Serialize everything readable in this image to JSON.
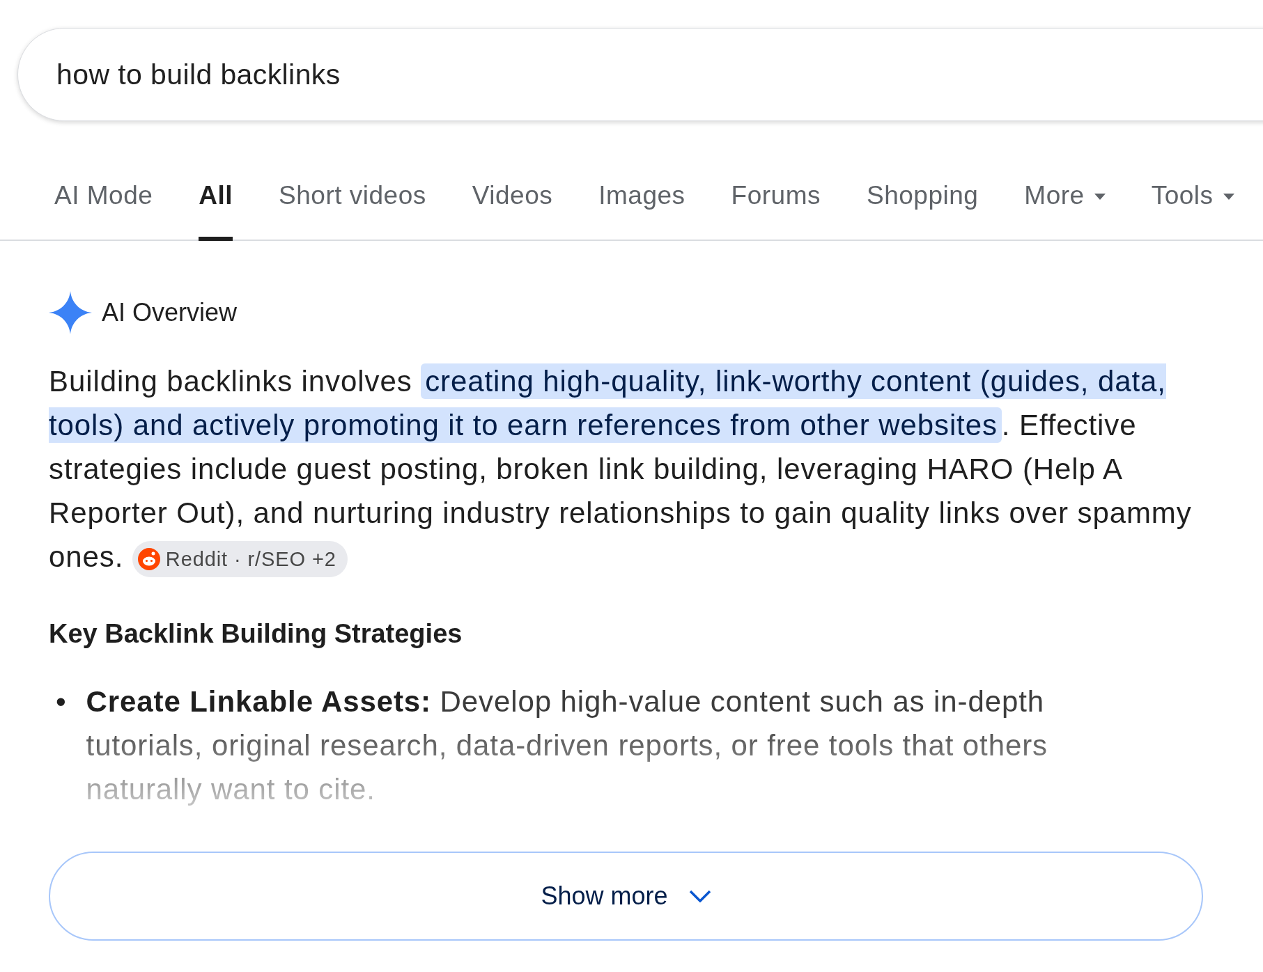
{
  "search": {
    "value": "how to build backlinks"
  },
  "tabs": [
    {
      "label": "AI Mode",
      "selected": false,
      "dropdown": false
    },
    {
      "label": "All",
      "selected": true,
      "dropdown": false
    },
    {
      "label": "Short videos",
      "selected": false,
      "dropdown": false
    },
    {
      "label": "Videos",
      "selected": false,
      "dropdown": false
    },
    {
      "label": "Images",
      "selected": false,
      "dropdown": false
    },
    {
      "label": "Forums",
      "selected": false,
      "dropdown": false
    },
    {
      "label": "Shopping",
      "selected": false,
      "dropdown": false
    },
    {
      "label": "More",
      "selected": false,
      "dropdown": true
    },
    {
      "label": "Tools",
      "selected": false,
      "dropdown": true
    }
  ],
  "overview": {
    "title": "AI Overview",
    "paragraph": [
      {
        "text": "Building backlinks involves ",
        "highlighted": false
      },
      {
        "text": "creating high-quality, link-worthy content (guides, data, tools) and actively promoting it to earn references from other websites",
        "highlighted": true
      },
      {
        "text": ". Effective strategies include guest posting, broken link building, leveraging HARO (Help A Reporter Out), and nurturing industry relationships to gain quality links over spammy ones. ",
        "highlighted": false
      }
    ],
    "citation": {
      "source": "Reddit · r/SEO",
      "more": "+2"
    },
    "heading": "Key Backlink Building Strategies",
    "bullets": [
      {
        "marker": "•",
        "label": "Create Linkable Assets:",
        "text": "Develop high-value content such as in-depth tutorials, original research, data-driven reports, or free tools that others naturally want to cite."
      }
    ],
    "show_more": "Show more"
  }
}
